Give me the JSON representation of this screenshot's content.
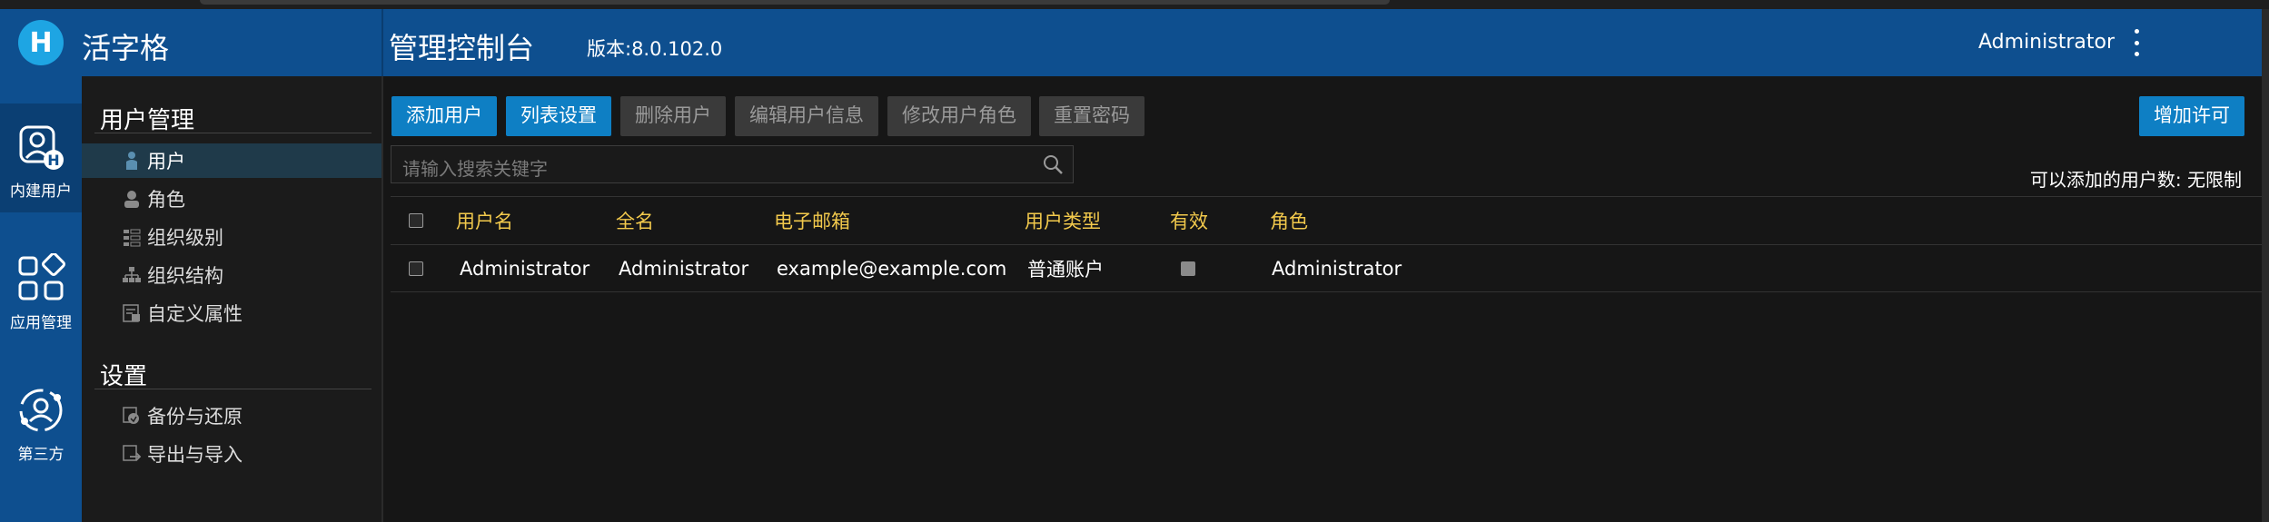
{
  "header": {
    "logo_letter": "H",
    "app_name": "活字格",
    "console_title": "管理控制台",
    "version": "版本:8.0.102.0",
    "user_name": "Administrator"
  },
  "rail": {
    "items": [
      {
        "label": "内建用户",
        "icon": "user-badge-icon",
        "active": true
      },
      {
        "label": "应用管理",
        "icon": "apps-grid-icon",
        "active": false
      },
      {
        "label": "第三方",
        "icon": "third-party-user-icon",
        "active": false
      }
    ]
  },
  "sidebar": {
    "user_section_title": "用户管理",
    "user_items": [
      {
        "label": "用户",
        "icon": "person-icon"
      },
      {
        "label": "角色",
        "icon": "role-icon"
      },
      {
        "label": "组织级别",
        "icon": "org-level-icon"
      },
      {
        "label": "组织结构",
        "icon": "org-structure-icon"
      },
      {
        "label": "自定义属性",
        "icon": "custom-attribute-icon"
      }
    ],
    "settings_section_title": "设置",
    "settings_items": [
      {
        "label": "备份与还原",
        "icon": "backup-icon"
      },
      {
        "label": "导出与导入",
        "icon": "export-import-icon"
      }
    ]
  },
  "toolbar": {
    "add_user": "添加用户",
    "list_settings": "列表设置",
    "delete_user": "删除用户",
    "edit_user_info": "编辑用户信息",
    "modify_user_role": "修改用户角色",
    "reset_password": "重置密码",
    "add_license": "增加许可"
  },
  "search": {
    "placeholder": "请输入搜索关键字"
  },
  "quota": "可以添加的用户数:  无限制",
  "table": {
    "headers": [
      "用户名",
      "全名",
      "电子邮箱",
      "用户类型",
      "有效",
      "角色"
    ],
    "rows": [
      {
        "username": "Administrator",
        "fullname": "Administrator",
        "email": "example@example.com",
        "type": "普通账户",
        "valid": true,
        "role": "Administrator"
      }
    ]
  },
  "colors": {
    "header_bg": "#0e4f8f",
    "primary_button": "#0e7fc4",
    "table_header_text": "#f2c94c"
  }
}
